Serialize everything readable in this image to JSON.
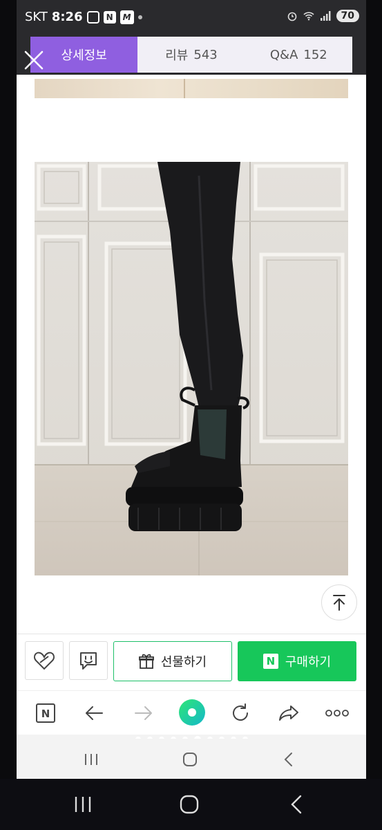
{
  "status_bar": {
    "carrier": "SKT",
    "time": "8:26",
    "battery": "70"
  },
  "tabs": [
    {
      "label": "상세정보",
      "count": ""
    },
    {
      "label": "리뷰",
      "count": "543"
    },
    {
      "label": "Q&A",
      "count": "152"
    }
  ],
  "actions": {
    "gift_label": "선물하기",
    "buy_label": "구매하기",
    "buy_badge": "N"
  },
  "browser": {
    "home_badge": "N"
  },
  "colors": {
    "accent_tab": "#8f5fe0",
    "buy_green": "#17c75a"
  },
  "icons": [
    "close-icon",
    "arrow-up-icon",
    "heart-share-icon",
    "chat-icon",
    "gift-icon",
    "back-arrow-icon",
    "forward-arrow-icon",
    "green-dot-icon",
    "refresh-icon",
    "share-arrow-icon",
    "more-icon",
    "recent-apps-icon",
    "home-icon",
    "nav-back-icon"
  ]
}
